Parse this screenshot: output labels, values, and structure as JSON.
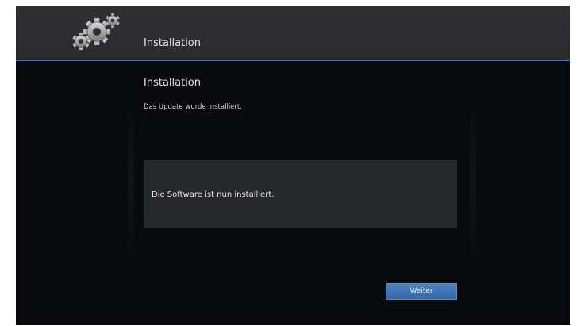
{
  "header": {
    "title": "Installation",
    "icon": "gears-icon"
  },
  "main": {
    "section_title": "Installation",
    "status_text": "Das Update wurde installiert.",
    "message": "Die Software ist nun installiert.",
    "next_button_label": "Weiter"
  },
  "colors": {
    "background": "#07090c",
    "header": "#2d2e31",
    "accent": "#3f73ad",
    "message_box": "#26282b",
    "button": "#3d72b3"
  }
}
